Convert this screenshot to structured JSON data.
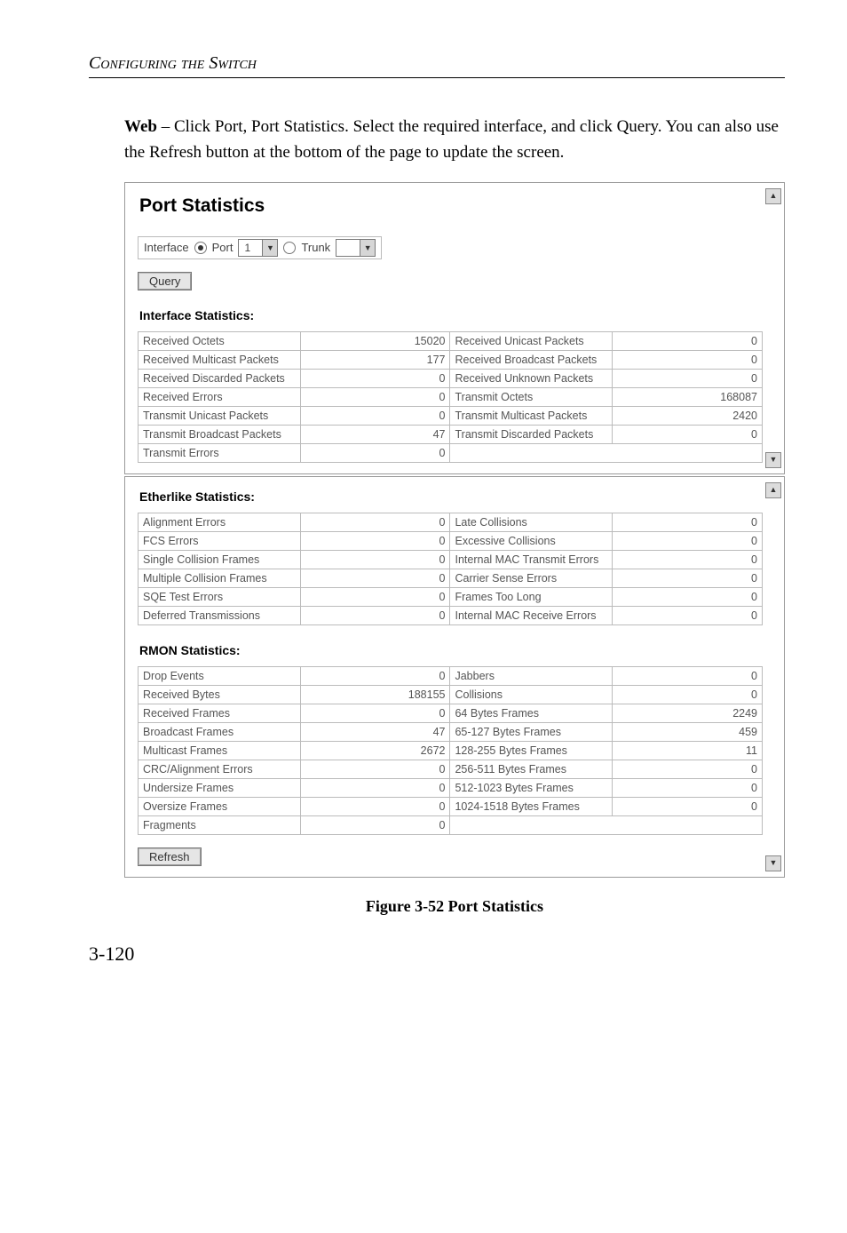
{
  "chapter_title": "Configuring the Switch",
  "body_prefix_bold": "Web",
  "body_text": " – Click Port, Port Statistics. Select the required interface, and click Query. You can also use the Refresh button at the bottom of the page to update the screen.",
  "panel_title": "Port Statistics",
  "interface_row": {
    "label": "Interface",
    "port_label": "Port",
    "port_value": "1",
    "trunk_label": "Trunk",
    "trunk_value": ""
  },
  "buttons": {
    "query": "Query",
    "refresh": "Refresh"
  },
  "sections": {
    "interface": "Interface Statistics:",
    "etherlike": "Etherlike Statistics:",
    "rmon": "RMON Statistics:"
  },
  "interface_stats": [
    {
      "l": "Received Octets",
      "v": "15020",
      "l2": "Received Unicast Packets",
      "v2": "0"
    },
    {
      "l": "Received Multicast Packets",
      "v": "177",
      "l2": "Received Broadcast Packets",
      "v2": "0"
    },
    {
      "l": "Received Discarded Packets",
      "v": "0",
      "l2": "Received Unknown Packets",
      "v2": "0"
    },
    {
      "l": "Received Errors",
      "v": "0",
      "l2": "Transmit Octets",
      "v2": "168087"
    },
    {
      "l": "Transmit Unicast Packets",
      "v": "0",
      "l2": "Transmit Multicast Packets",
      "v2": "2420"
    },
    {
      "l": "Transmit Broadcast Packets",
      "v": "47",
      "l2": "Transmit Discarded Packets",
      "v2": "0"
    },
    {
      "l": "Transmit Errors",
      "v": "0",
      "l2": "",
      "v2": ""
    }
  ],
  "etherlike_stats": [
    {
      "l": "Alignment Errors",
      "v": "0",
      "l2": "Late Collisions",
      "v2": "0"
    },
    {
      "l": "FCS Errors",
      "v": "0",
      "l2": "Excessive Collisions",
      "v2": "0"
    },
    {
      "l": "Single Collision Frames",
      "v": "0",
      "l2": "Internal MAC Transmit Errors",
      "v2": "0"
    },
    {
      "l": "Multiple Collision Frames",
      "v": "0",
      "l2": "Carrier Sense Errors",
      "v2": "0"
    },
    {
      "l": "SQE Test Errors",
      "v": "0",
      "l2": "Frames Too Long",
      "v2": "0"
    },
    {
      "l": "Deferred Transmissions",
      "v": "0",
      "l2": "Internal MAC Receive Errors",
      "v2": "0"
    }
  ],
  "rmon_stats": [
    {
      "l": "Drop Events",
      "v": "0",
      "l2": "Jabbers",
      "v2": "0"
    },
    {
      "l": "Received Bytes",
      "v": "188155",
      "l2": "Collisions",
      "v2": "0"
    },
    {
      "l": "Received Frames",
      "v": "0",
      "l2": "64 Bytes Frames",
      "v2": "2249"
    },
    {
      "l": "Broadcast Frames",
      "v": "47",
      "l2": "65-127 Bytes Frames",
      "v2": "459"
    },
    {
      "l": "Multicast Frames",
      "v": "2672",
      "l2": "128-255 Bytes Frames",
      "v2": "11"
    },
    {
      "l": "CRC/Alignment Errors",
      "v": "0",
      "l2": "256-511 Bytes Frames",
      "v2": "0"
    },
    {
      "l": "Undersize Frames",
      "v": "0",
      "l2": "512-1023 Bytes Frames",
      "v2": "0"
    },
    {
      "l": "Oversize Frames",
      "v": "0",
      "l2": "1024-1518 Bytes Frames",
      "v2": "0"
    },
    {
      "l": "Fragments",
      "v": "0",
      "l2": "",
      "v2": ""
    }
  ],
  "figure_caption": "Figure 3-52  Port Statistics",
  "page_number": "3-120"
}
